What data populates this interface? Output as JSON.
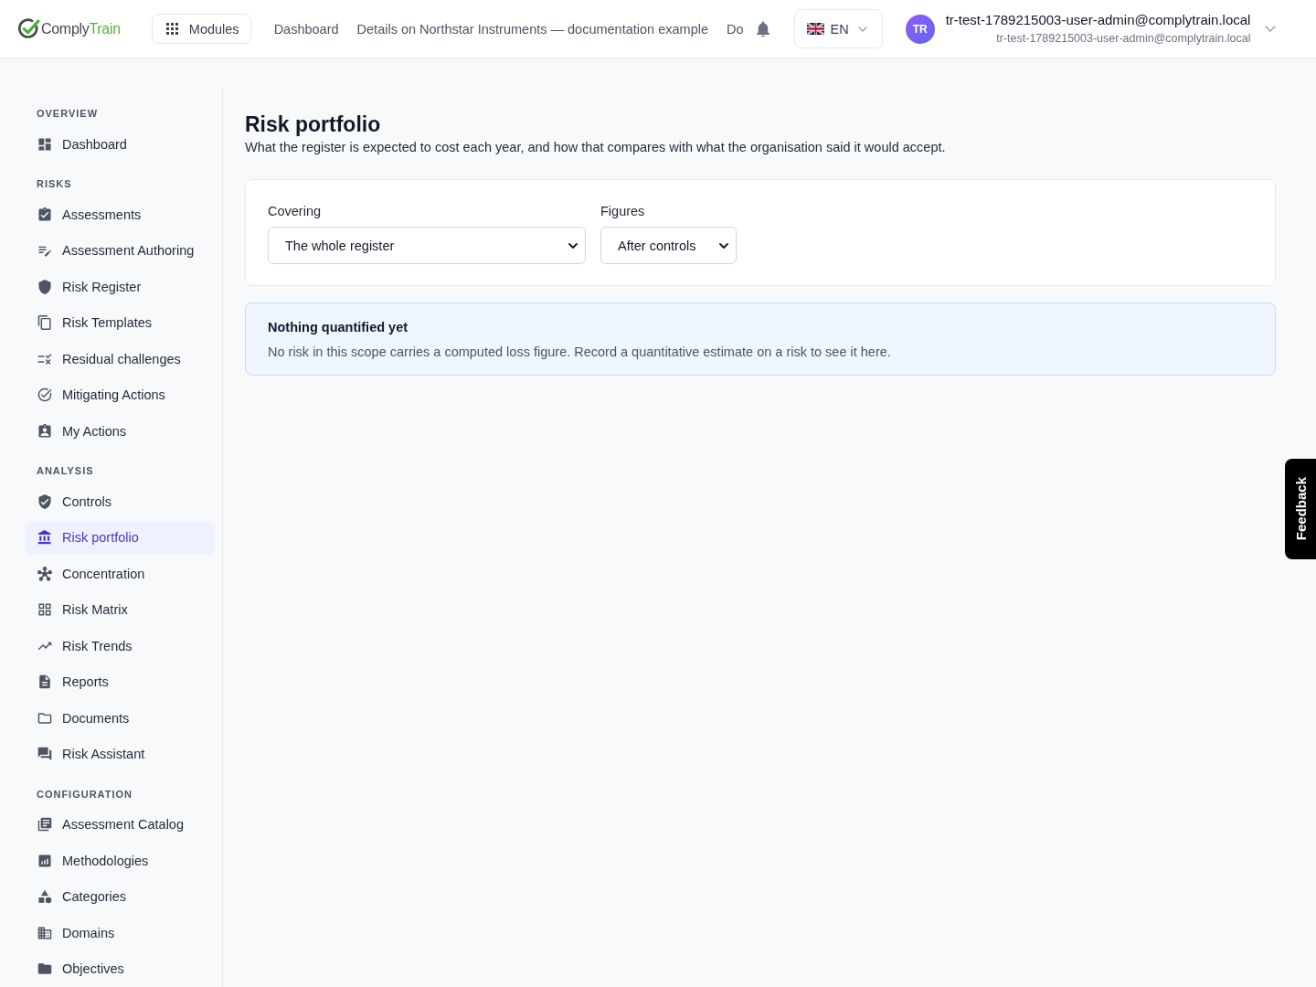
{
  "top_bar": {
    "logo": {
      "parts": [
        "Comply",
        "Train"
      ]
    },
    "modules_button": "Modules",
    "nav_links": [
      "Dashboard",
      "Details on Northstar Instruments — documentation example",
      "Do"
    ],
    "language": "EN",
    "user": {
      "initials": "TR",
      "name": "tr-test-1789215003-user-admin@complytrain.local",
      "email": "tr-test-1789215003-user-admin@complytrain.local"
    }
  },
  "sidebar": {
    "sections": [
      {
        "title": "OVERVIEW",
        "items": [
          {
            "label": "Dashboard",
            "selected": false
          }
        ]
      },
      {
        "title": "RISKS",
        "items": [
          {
            "label": "Assessments",
            "selected": false
          },
          {
            "label": "Assessment Authoring",
            "selected": false
          },
          {
            "label": "Risk Register",
            "selected": false
          },
          {
            "label": "Risk Templates",
            "selected": false
          },
          {
            "label": "Residual challenges",
            "selected": false
          },
          {
            "label": "Mitigating Actions",
            "selected": false
          },
          {
            "label": "My Actions",
            "selected": false
          }
        ]
      },
      {
        "title": "ANALYSIS",
        "items": [
          {
            "label": "Controls",
            "selected": false
          },
          {
            "label": "Risk portfolio",
            "selected": true
          },
          {
            "label": "Concentration",
            "selected": false
          },
          {
            "label": "Risk Matrix",
            "selected": false
          },
          {
            "label": "Risk Trends",
            "selected": false
          },
          {
            "label": "Reports",
            "selected": false
          },
          {
            "label": "Documents",
            "selected": false
          },
          {
            "label": "Risk Assistant",
            "selected": false
          }
        ]
      },
      {
        "title": "CONFIGURATION",
        "items": [
          {
            "label": "Assessment Catalog",
            "selected": false
          },
          {
            "label": "Methodologies",
            "selected": false
          },
          {
            "label": "Categories",
            "selected": false
          },
          {
            "label": "Domains",
            "selected": false
          },
          {
            "label": "Objectives",
            "selected": false
          }
        ]
      }
    ]
  },
  "page": {
    "title": "Risk portfolio",
    "subtitle": "What the register is expected to cost each year, and how that compares with what the organisation said it would accept.",
    "filters": [
      {
        "label": "Covering",
        "value": "The whole register"
      },
      {
        "label": "Figures",
        "value": "After controls"
      }
    ],
    "notice": {
      "title": "Nothing quantified yet",
      "text": "No risk in this scope carries a computed loss figure. Record a quantitative estimate on a risk to see it here."
    }
  },
  "feedback_tab": "Feedback"
}
